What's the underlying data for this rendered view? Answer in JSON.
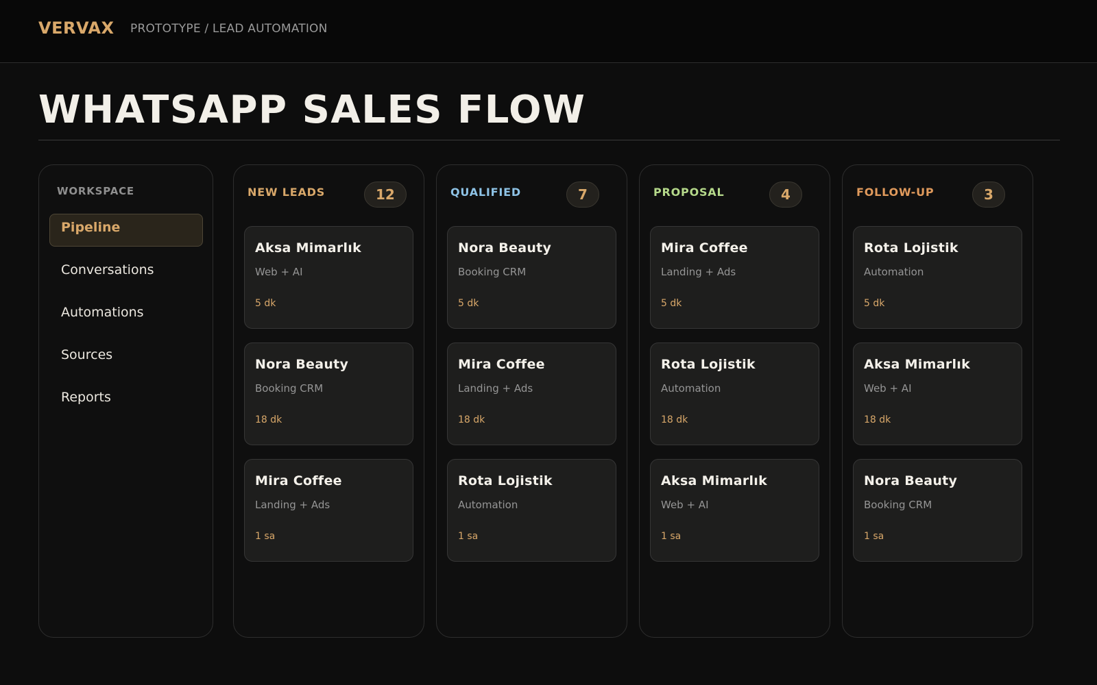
{
  "header": {
    "brand": "VERVAX",
    "breadcrumb": "PROTOTYPE / LEAD AUTOMATION"
  },
  "page": {
    "title": "WHATSAPP SALES FLOW"
  },
  "sidebar": {
    "heading": "WORKSPACE",
    "items": [
      {
        "label": "Pipeline",
        "active": true
      },
      {
        "label": "Conversations"
      },
      {
        "label": "Automations"
      },
      {
        "label": "Sources"
      },
      {
        "label": "Reports"
      }
    ]
  },
  "columns": [
    {
      "title": "NEW LEADS",
      "count": "12",
      "color": "#d9a86a",
      "cards": [
        {
          "name": "Aksa Mimarlık",
          "service": "Web + AI",
          "time": "5 dk"
        },
        {
          "name": "Nora Beauty",
          "service": "Booking CRM",
          "time": "18 dk"
        },
        {
          "name": "Mira Coffee",
          "service": "Landing + Ads",
          "time": "1 sa"
        }
      ]
    },
    {
      "title": "QUALIFIED",
      "count": "7",
      "color": "#8ec3e6",
      "cards": [
        {
          "name": "Nora Beauty",
          "service": "Booking CRM",
          "time": "5 dk"
        },
        {
          "name": "Mira Coffee",
          "service": "Landing + Ads",
          "time": "18 dk"
        },
        {
          "name": "Rota Lojistik",
          "service": "Automation",
          "time": "1 sa"
        }
      ]
    },
    {
      "title": "PROPOSAL",
      "count": "4",
      "color": "#b5d98a",
      "cards": [
        {
          "name": "Mira Coffee",
          "service": "Landing + Ads",
          "time": "5 dk"
        },
        {
          "name": "Rota Lojistik",
          "service": "Automation",
          "time": "18 dk"
        },
        {
          "name": "Aksa Mimarlık",
          "service": "Web + AI",
          "time": "1 sa"
        }
      ]
    },
    {
      "title": "FOLLOW-UP",
      "count": "3",
      "color": "#e09a5c",
      "cards": [
        {
          "name": "Rota Lojistik",
          "service": "Automation",
          "time": "5 dk"
        },
        {
          "name": "Aksa Mimarlık",
          "service": "Web + AI",
          "time": "18 dk"
        },
        {
          "name": "Nora Beauty",
          "service": "Booking CRM",
          "time": "1 sa"
        }
      ]
    }
  ]
}
